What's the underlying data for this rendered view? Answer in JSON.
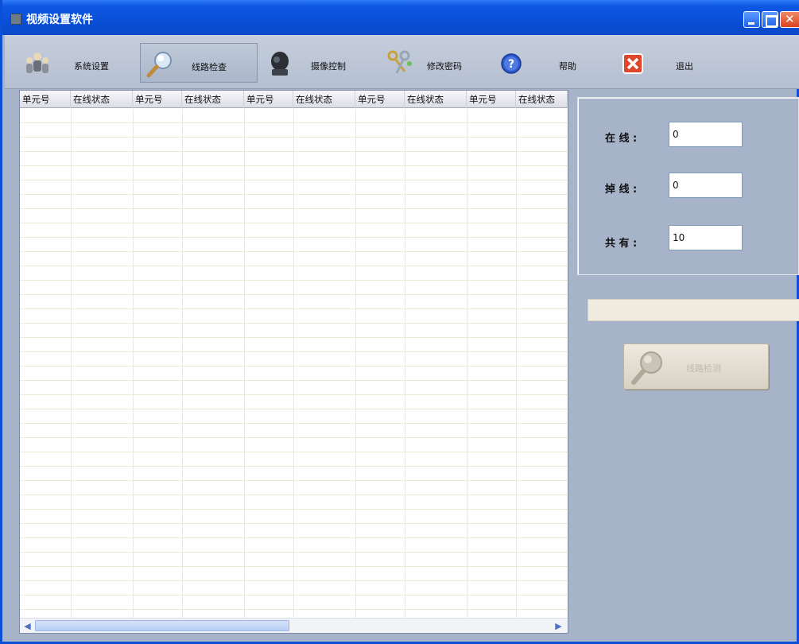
{
  "window": {
    "title": "视频设置软件"
  },
  "toolbar": {
    "items": [
      {
        "label": "系统设置",
        "icon": "users-group-icon"
      },
      {
        "label": "线路检查",
        "icon": "magnifier-icon"
      },
      {
        "label": "摄像控制",
        "icon": "camera-icon"
      },
      {
        "label": "修改密码",
        "icon": "keys-icon"
      },
      {
        "label": "帮助",
        "icon": "help-icon"
      },
      {
        "label": "退出",
        "icon": "exit-icon"
      }
    ]
  },
  "table": {
    "columns": [
      "单元号",
      "在线状态",
      "单元号",
      "在线状态",
      "单元号",
      "在线状态",
      "单元号",
      "在线状态",
      "单元号",
      "在线状态"
    ]
  },
  "stats": {
    "online_label": "在 线 :",
    "online_value": "0",
    "offline_label": "掉 线 :",
    "offline_value": "0",
    "total_label": "共 有 :",
    "total_value": "10"
  },
  "check_button": {
    "label": "线路检测"
  },
  "colors": {
    "titlebar": "#0a4fd8",
    "window_bg": "#a7b3c9",
    "table_grid": "#ece9d4"
  }
}
